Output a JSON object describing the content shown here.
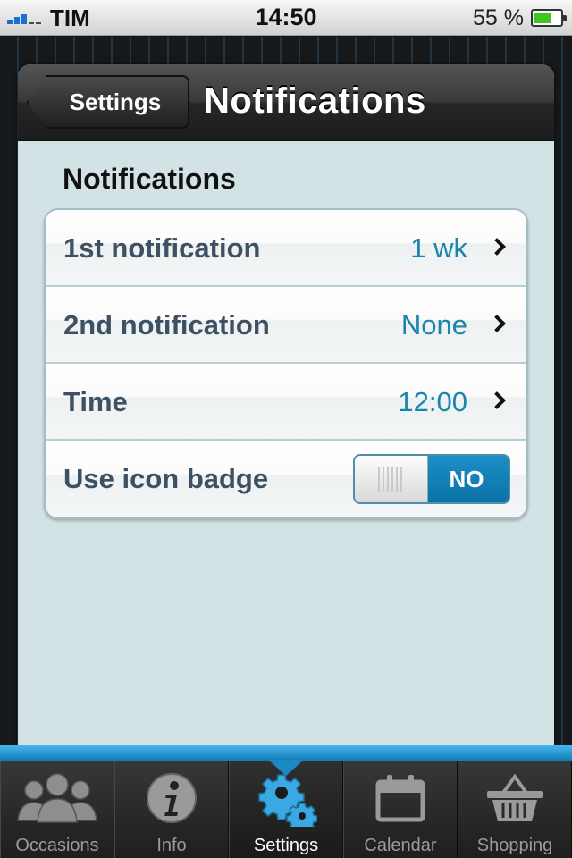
{
  "status_bar": {
    "carrier": "TIM",
    "time": "14:50",
    "battery_percent": "55 %",
    "battery_level": 0.55,
    "signal_bars": 2
  },
  "nav": {
    "back_label": "Settings",
    "title": "Notifications"
  },
  "section": {
    "header": "Notifications"
  },
  "rows": [
    {
      "label": "1st notification",
      "value": "1 wk"
    },
    {
      "label": "2nd notification",
      "value": "None"
    },
    {
      "label": "Time",
      "value": "12:00"
    }
  ],
  "badge_row": {
    "label": "Use icon badge",
    "toggle_label": "NO",
    "enabled": false
  },
  "tabs": [
    {
      "label": "Occasions",
      "icon": "people-icon",
      "active": false
    },
    {
      "label": "Info",
      "icon": "info-icon",
      "active": false
    },
    {
      "label": "Settings",
      "icon": "gears-icon",
      "active": true
    },
    {
      "label": "Calendar",
      "icon": "calendar-icon",
      "active": false
    },
    {
      "label": "Shopping",
      "icon": "basket-icon",
      "active": false
    }
  ],
  "colors": {
    "accent": "#1a84ad",
    "tab_active": "#3aa9e3",
    "card_background": "#d3e3e5"
  }
}
